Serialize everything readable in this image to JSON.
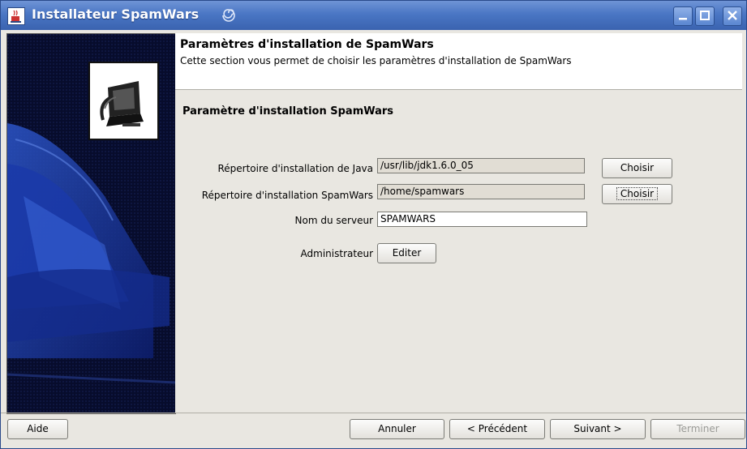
{
  "window": {
    "title": "Installateur SpamWars"
  },
  "banner": {
    "title": "Paramètres d'installation de SpamWars",
    "subtitle": "Cette section vous permet de choisir les paramètres d'installation de SpamWars"
  },
  "section": {
    "title": "Paramètre d'installation SpamWars"
  },
  "form": {
    "java_dir": {
      "label": "Répertoire d'installation de Java",
      "value": "/usr/lib/jdk1.6.0_05",
      "button": "Choisir"
    },
    "spamwars_dir": {
      "label": "Répertoire d'installation SpamWars",
      "value": "/home/spamwars",
      "button": "Choisir"
    },
    "server_name": {
      "label": "Nom du serveur",
      "value": "SPAMWARS"
    },
    "admin": {
      "label": "Administrateur",
      "button": "Editer"
    }
  },
  "footer": {
    "help": "Aide",
    "cancel": "Annuler",
    "previous": "< Précédent",
    "next": "Suivant >",
    "finish": "Terminer"
  },
  "colors": {
    "titlebar": "#4a76c4",
    "left_panel": "#050a25",
    "accent_blue": "#2a4fb0"
  }
}
